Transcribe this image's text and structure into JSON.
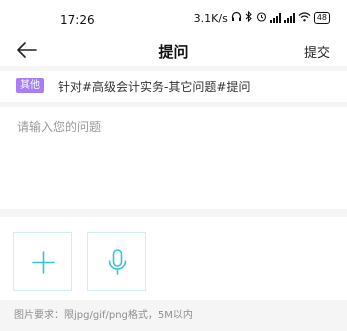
{
  "status": {
    "time": "17:26",
    "speed": "3.1K/s",
    "battery": "48"
  },
  "nav": {
    "title": "提问",
    "submit_label": "提交"
  },
  "topic": {
    "badge": "其他",
    "text": "针对#高级会计实务-其它问题#提问"
  },
  "question": {
    "placeholder": "请输入您的问题"
  },
  "upload": {
    "hint": "图片要求：限jpg/gif/png格式，5M以内"
  },
  "colors": {
    "accent": "#35c5d6",
    "badge": "#a77ef5"
  },
  "icons": {
    "back": "arrow-left-icon",
    "add": "plus-icon",
    "mic": "microphone-icon"
  }
}
